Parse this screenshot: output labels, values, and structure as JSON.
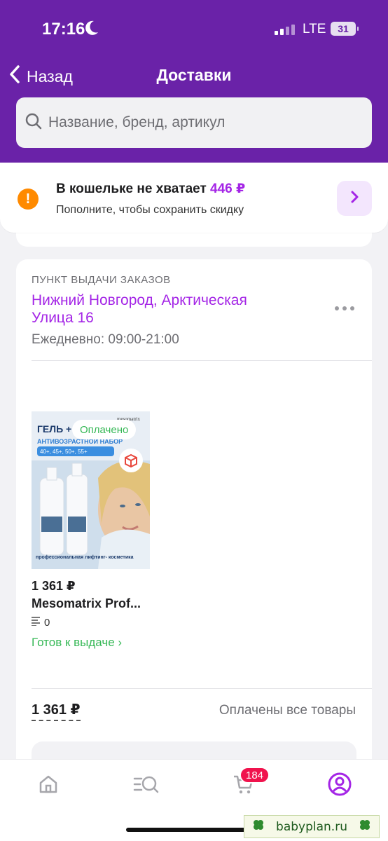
{
  "status_bar": {
    "time": "17:16",
    "network": "LTE",
    "battery": "31"
  },
  "nav": {
    "back_label": "Назад",
    "title": "Доставки"
  },
  "search": {
    "placeholder": "Название, бренд, артикул"
  },
  "wallet": {
    "title_prefix": "В кошельке не хватает ",
    "amount": "446 ₽",
    "subtitle": "Пополните, чтобы сохранить скидку"
  },
  "order": {
    "pickup_label": "ПУНКТ ВЫДАЧИ ЗАКАЗОВ",
    "pickup_address": "Нижний Новгород, Арктическая Улица 16",
    "pickup_hours": "Ежедневно: 09:00-21:00",
    "product": {
      "badge": "Оплачено",
      "price": "1 361 ₽",
      "name": "Mesomatrix Prof...",
      "quantity": "0",
      "status": "Готов к выдаче ›",
      "image_text": {
        "brand": "mesomatrix",
        "headline": "ГЕЛЬ +",
        "subheadline": "АНТИВОЗРАСТНОЙ НАБОР",
        "ages": "40+, 45+, 50+, 55+",
        "tagline": "профессиональная лифтинг- косметика"
      }
    },
    "total": "1 361 ₽",
    "payment_status": "Оплачены все товары"
  },
  "tabbar": {
    "cart_count": "184"
  },
  "watermark": {
    "text": "babyplan.ru"
  },
  "colors": {
    "header_bg": "#6a22a8",
    "accent": "#a425e6",
    "success": "#36b856",
    "warning": "#ff8a00",
    "badge": "#f0134d"
  }
}
